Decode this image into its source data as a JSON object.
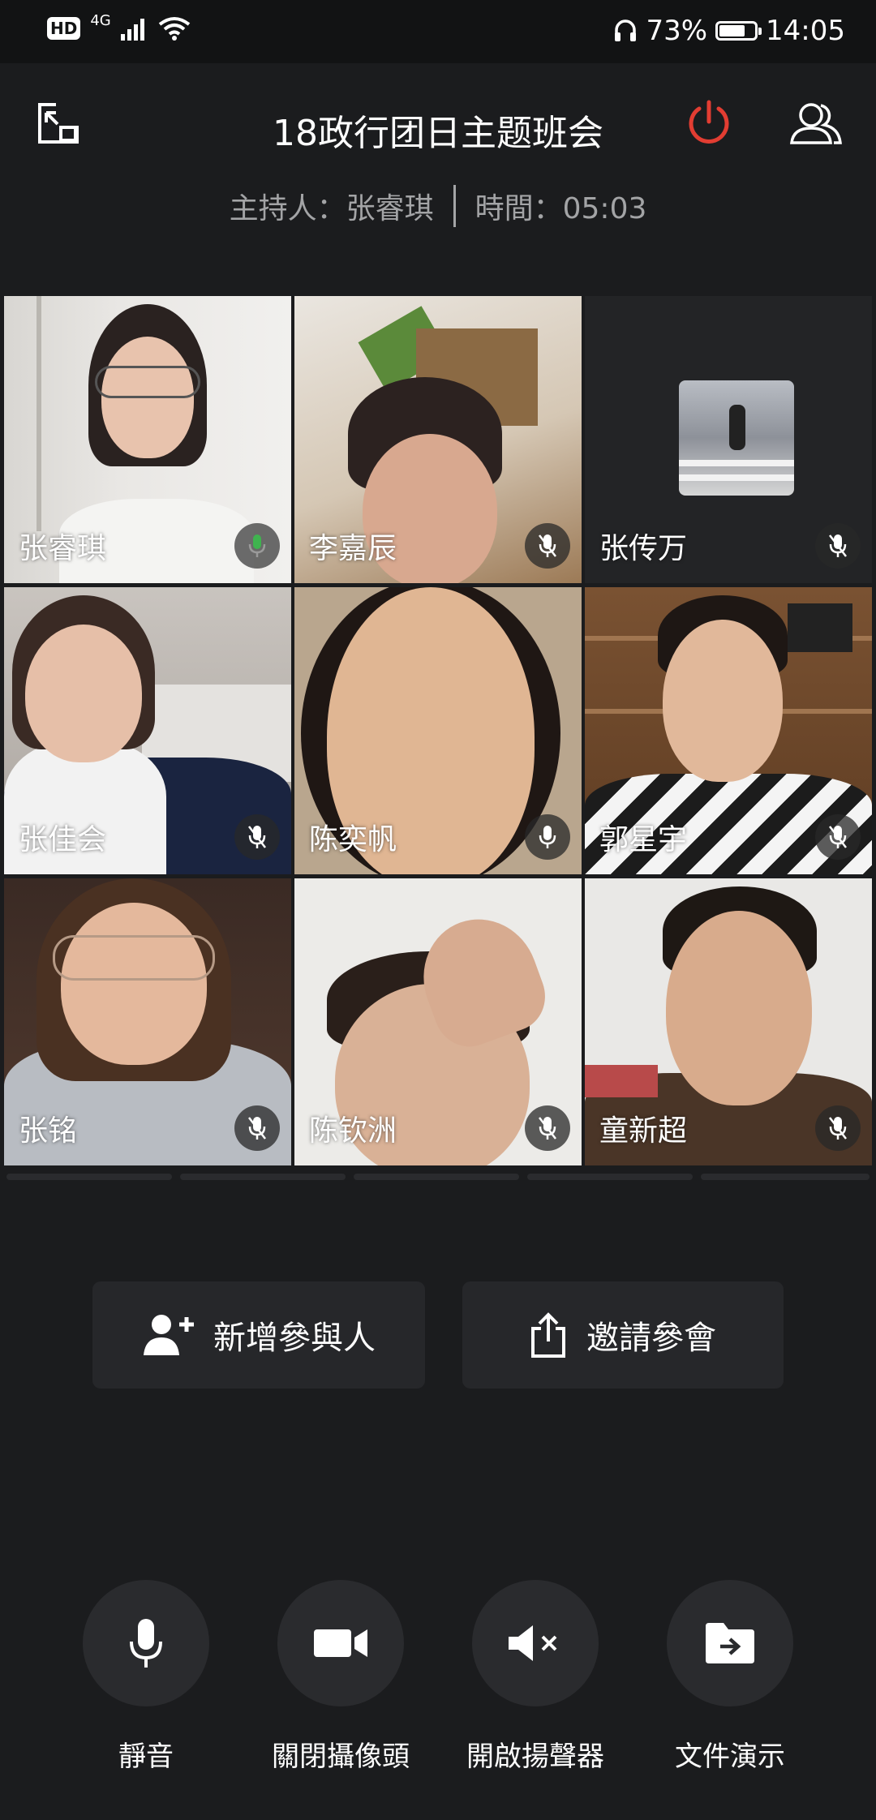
{
  "status_bar": {
    "hd": "HD",
    "network": "4G",
    "battery": "73%",
    "battery_level": 0.73,
    "time": "14:05"
  },
  "header": {
    "title": "18政行团日主题班会",
    "host": "主持人：张睿琪",
    "time": "時間：05:03"
  },
  "colors": {
    "background": "#1b1c1e",
    "power_red": "#e23d32",
    "muted_text": "#a3a4a6",
    "mic_active": "#3fb34f"
  },
  "participants": [
    {
      "name": "张睿琪",
      "mic": "active-mic-icon"
    },
    {
      "name": "李嘉辰",
      "mic": "mic-muted-icon"
    },
    {
      "name": "张传万",
      "mic": "mic-muted-icon"
    },
    {
      "name": "张佳会",
      "mic": "mic-muted-icon"
    },
    {
      "name": "陈奕帆",
      "mic": "mic-icon"
    },
    {
      "name": "郭星宇",
      "mic": "mic-muted-icon"
    },
    {
      "name": "张铭",
      "mic": "mic-muted-icon"
    },
    {
      "name": "陈钦洲",
      "mic": "mic-muted-icon"
    },
    {
      "name": "童新超",
      "mic": "mic-muted-icon"
    }
  ],
  "actions": {
    "add_participant": "新增參與人",
    "invite": "邀請參會"
  },
  "controls": {
    "mute": "靜音",
    "camera_off": "關閉攝像頭",
    "speaker_on": "開啟揚聲器",
    "file_present": "文件演示"
  }
}
